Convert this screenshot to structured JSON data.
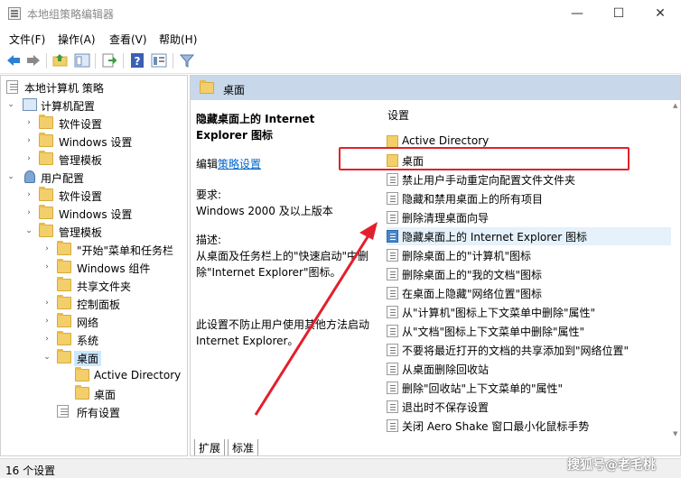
{
  "window": {
    "title": "本地组策略编辑器",
    "min": "—",
    "max": "☐",
    "close": "✕"
  },
  "menu": [
    "文件(F)",
    "操作(A)",
    "查看(V)",
    "帮助(H)"
  ],
  "tree": {
    "root": "本地计算机 策略",
    "computer": "计算机配置",
    "computer_children": [
      "软件设置",
      "Windows 设置",
      "管理模板"
    ],
    "user": "用户配置",
    "user_children": [
      "软件设置",
      "Windows 设置",
      "管理模板"
    ],
    "admin_children": [
      "\"开始\"菜单和任务栏",
      "Windows 组件",
      "共享文件夹",
      "控制面板",
      "网络",
      "系统",
      "桌面"
    ],
    "desktop_children": [
      "Active Directory",
      "桌面"
    ],
    "all_settings": "所有设置"
  },
  "header": {
    "folder": "桌面"
  },
  "description": {
    "title": "隐藏桌面上的 Internet Explorer 图标",
    "edit_prefix": "编辑",
    "edit_link": "策略设置",
    "req_label": "要求:",
    "req_value": "Windows 2000 及以上版本",
    "desc_label": "描述:",
    "desc_text": "从桌面及任务栏上的\"快速启动\"中删除\"Internet Explorer\"图标。",
    "desc_text2": "此设置不防止用户使用其他方法启动 Internet Explorer。"
  },
  "list": {
    "header": "设置",
    "items": [
      {
        "label": "Active Directory",
        "type": "folder"
      },
      {
        "label": "桌面",
        "type": "folder"
      },
      {
        "label": "禁止用户手动重定向配置文件文件夹",
        "type": "policy"
      },
      {
        "label": "隐藏和禁用桌面上的所有项目",
        "type": "policy"
      },
      {
        "label": "删除清理桌面向导",
        "type": "policy"
      },
      {
        "label": "隐藏桌面上的 Internet Explorer 图标",
        "type": "policy-selected"
      },
      {
        "label": "删除桌面上的\"计算机\"图标",
        "type": "policy"
      },
      {
        "label": "删除桌面上的\"我的文档\"图标",
        "type": "policy"
      },
      {
        "label": "在桌面上隐藏\"网络位置\"图标",
        "type": "policy"
      },
      {
        "label": "从\"计算机\"图标上下文菜单中删除\"属性\"",
        "type": "policy"
      },
      {
        "label": "从\"文档\"图标上下文菜单中删除\"属性\"",
        "type": "policy"
      },
      {
        "label": "不要将最近打开的文档的共享添加到\"网络位置\"",
        "type": "policy"
      },
      {
        "label": "从桌面删除回收站",
        "type": "policy"
      },
      {
        "label": "删除\"回收站\"上下文菜单的\"属性\"",
        "type": "policy"
      },
      {
        "label": "退出时不保存设置",
        "type": "policy"
      },
      {
        "label": "关闭 Aero Shake 窗口最小化鼠标手势",
        "type": "policy"
      }
    ]
  },
  "tabs": [
    "扩展",
    "标准"
  ],
  "status": "16 个设置",
  "watermark": "搜狐号@老毛桃",
  "colors": {
    "header_bg": "#c8d8ea",
    "highlight": "#e2202b",
    "selection": "#cce8ff"
  }
}
